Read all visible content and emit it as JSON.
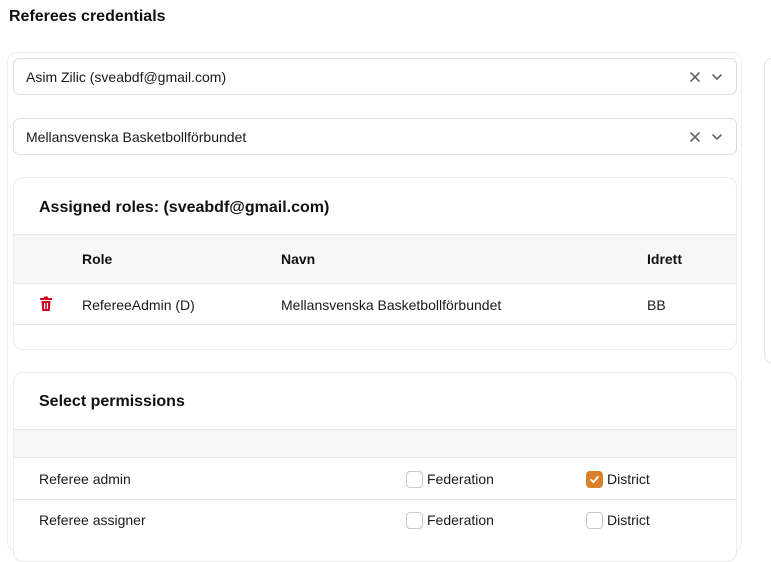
{
  "page": {
    "title": "Referees credentials"
  },
  "selects": {
    "user": {
      "value": "Asim Zilic (sveabdf@gmail.com)"
    },
    "federation": {
      "value": "Mellansvenska Basketbollförbundet"
    }
  },
  "roles_card": {
    "title": "Assigned roles: (sveabdf@gmail.com)",
    "columns": {
      "role": "Role",
      "name": "Navn",
      "sport": "Idrett"
    },
    "rows": [
      {
        "role": "RefereeAdmin (D)",
        "name": "Mellansvenska Basketbollförbundet",
        "sport": "BB"
      }
    ]
  },
  "permissions_card": {
    "title": "Select permissions",
    "rows": [
      {
        "label": "Referee admin",
        "federation_label": "Federation",
        "federation_checked": false,
        "district_label": "District",
        "district_checked": true
      },
      {
        "label": "Referee assigner",
        "federation_label": "Federation",
        "federation_checked": false,
        "district_label": "District",
        "district_checked": false
      }
    ]
  },
  "colors": {
    "accent": "#d9822b",
    "danger": "#d0021b"
  },
  "icons": {
    "clear": "close-icon",
    "expand": "chevron-down-icon",
    "delete": "trash-icon",
    "check": "checkmark-icon"
  }
}
